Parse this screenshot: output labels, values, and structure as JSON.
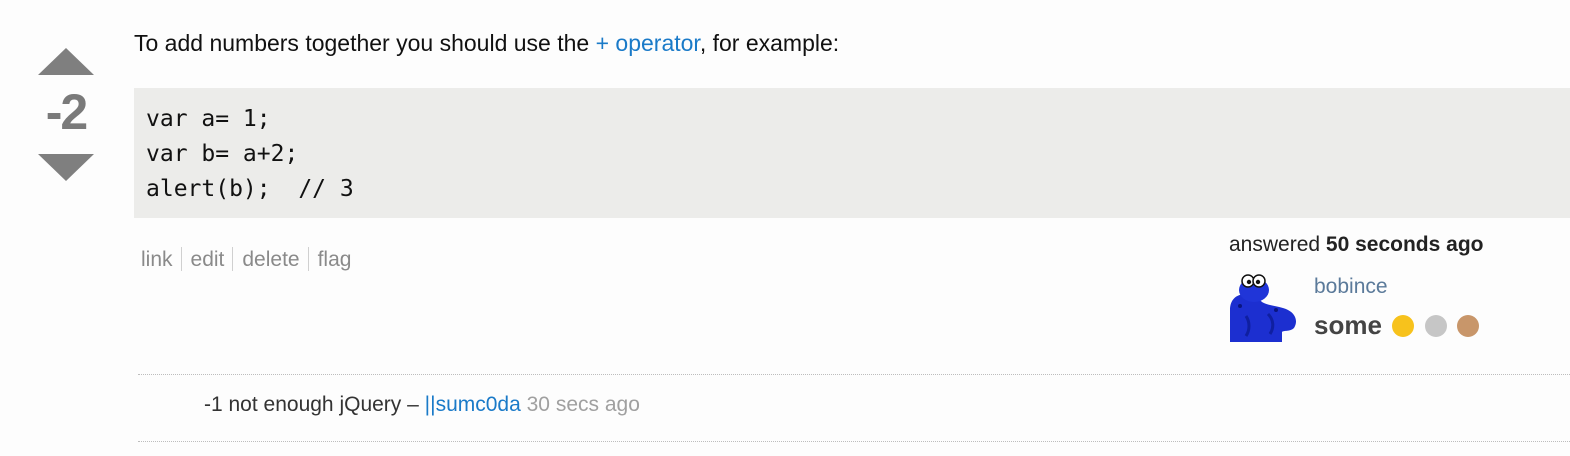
{
  "vote": {
    "count": "-2"
  },
  "post": {
    "text_before": "To add numbers together you should use the ",
    "link_text": "+ operator",
    "text_after": ", for example:",
    "code_lines": [
      "var a= 1;",
      "var b= a+2;",
      "alert(b);  // 3"
    ]
  },
  "menu": {
    "items": [
      "link",
      "edit",
      "delete",
      "flag"
    ]
  },
  "user": {
    "action_prefix": "answered",
    "action_time": "50 seconds ago",
    "name": "bobince",
    "reputation": "some",
    "badge_colors": [
      "#f7c21c",
      "#c6c6c6",
      "#c8966a"
    ],
    "avatar_icon": "blue-monster-avatar"
  },
  "comment": {
    "text": "-1 not enough jQuery – ",
    "user": "||sumc0da",
    "date": "30 secs ago"
  },
  "colors": {
    "link": "#1a7ac8",
    "code_bg": "#ececea",
    "vote_arrow": "#7f7f7f"
  }
}
